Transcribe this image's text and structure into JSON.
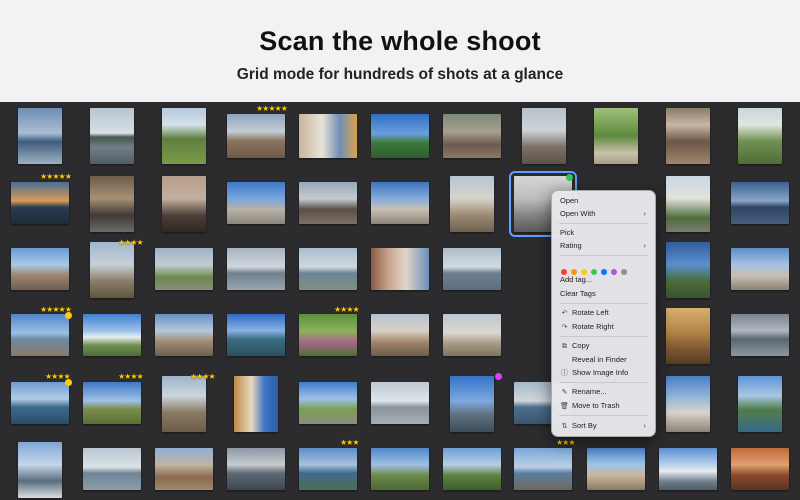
{
  "hero": {
    "title": "Scan the whole shoot",
    "subtitle": "Grid mode for hundreds of shots at a glance"
  },
  "rating_badges": [
    "★★★★★",
    "★★★★★",
    "★★★★",
    "★★★★★",
    "★★★★",
    "★★★★",
    "★★★★",
    "★★★★",
    "★★★",
    "★★★"
  ],
  "context_menu": {
    "open": "Open",
    "open_with": "Open With",
    "pick": "Pick",
    "rating": "Rating",
    "color_labels": [
      "#ff3b30",
      "#ff9500",
      "#ffcc00",
      "#34c759",
      "#007aff",
      "#af52de",
      "#8e8e93"
    ],
    "add_tag": "Add tag...",
    "clear_tags": "Clear Tags",
    "rotate_left": "Rotate Left",
    "rotate_right": "Rotate Right",
    "copy": "Copy",
    "reveal_in_finder": "Reveal in Finder",
    "show_image_info": "Show Image Info",
    "rename": "Rename...",
    "move_to_trash": "Move to Trash",
    "sort_by": "Sort By",
    "submenu_arrow": "›"
  },
  "icons": {
    "rotate_left": "↶",
    "rotate_right": "↷",
    "copy": "⧉",
    "info": "ⓘ",
    "rename": "✎",
    "trash": "🗑",
    "sort": "⇅"
  },
  "colors": {
    "selection": "#5ea1ff",
    "pick_dot": "#34c759",
    "label_dot": "#e040fb",
    "star": "#ffcc00"
  }
}
